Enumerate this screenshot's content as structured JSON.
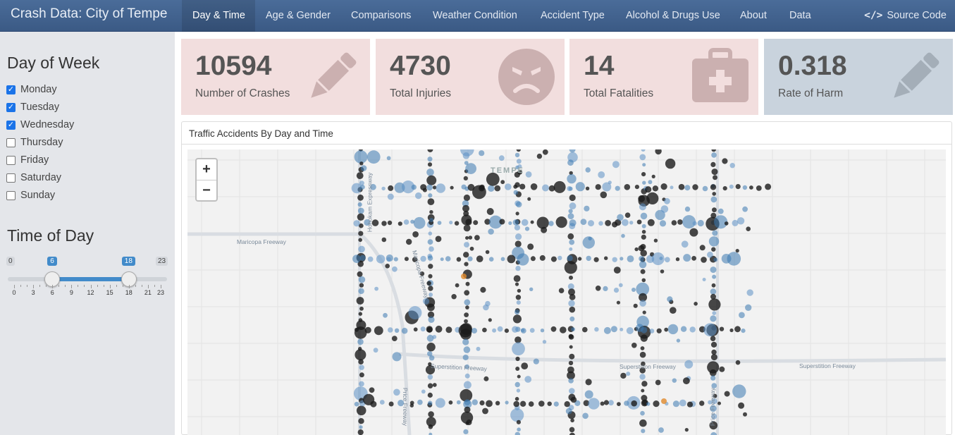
{
  "navbar": {
    "brand": "Crash Data: City of Tempe",
    "items": [
      "Day & Time",
      "Age & Gender",
      "Comparisons",
      "Weather Condition",
      "Accident Type",
      "Alcohol & Drugs Use",
      "About",
      "Data"
    ],
    "active_item": "Day & Time",
    "source_label": "Source Code",
    "source_icon": "code-icon"
  },
  "sidebar": {
    "day_heading": "Day of Week",
    "days": [
      {
        "label": "Monday",
        "checked": true
      },
      {
        "label": "Tuesday",
        "checked": true
      },
      {
        "label": "Wednesday",
        "checked": true
      },
      {
        "label": "Thursday",
        "checked": false
      },
      {
        "label": "Friday",
        "checked": false
      },
      {
        "label": "Saturday",
        "checked": false
      },
      {
        "label": "Sunday",
        "checked": false
      }
    ],
    "time_heading": "Time of Day",
    "slider": {
      "min": "0",
      "max": "23",
      "from": "6",
      "to": "18",
      "ticks": [
        "0",
        "3",
        "6",
        "9",
        "12",
        "15",
        "18",
        "21",
        "23"
      ]
    }
  },
  "value_boxes": [
    {
      "value": "10594",
      "label": "Number of Crashes",
      "icon": "pencil-icon",
      "color": "#f2dede"
    },
    {
      "value": "4730",
      "label": "Total Injuries",
      "icon": "angry-face-icon",
      "color": "#f2dede"
    },
    {
      "value": "14",
      "label": "Total Fatalities",
      "icon": "medkit-icon",
      "color": "#f2dede"
    },
    {
      "value": "0.318",
      "label": "Rate of Harm",
      "icon": "pencil-icon",
      "color": "#c9d3dd"
    }
  ],
  "map_panel": {
    "title": "Traffic Accidents By Day and Time",
    "zoom_in": "+",
    "zoom_out": "−",
    "labels": [
      "Maricopa Freeway",
      "Maricopa Freeway",
      "Superstition Freeway",
      "Superstition Freeway",
      "Superstition Freeway",
      "TEMPE",
      "Price Freeway",
      "Price Freeway",
      "Hohokam Expressway"
    ],
    "point_colors": [
      "#1a1a1a",
      "#3b78b0",
      "#5b8fc4",
      "#e08a2c"
    ]
  }
}
